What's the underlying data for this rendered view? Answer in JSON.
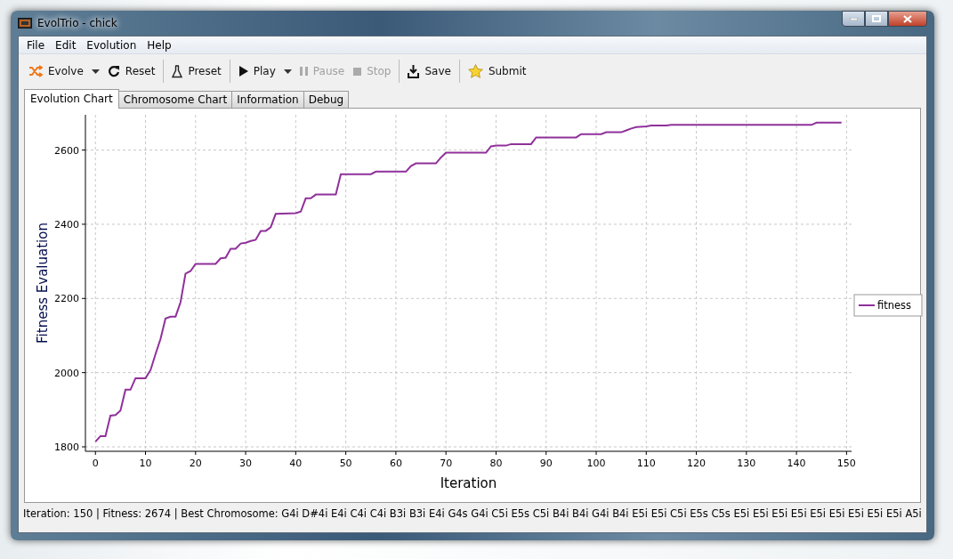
{
  "window": {
    "title": "EvolTrio - chick"
  },
  "menu": [
    "File",
    "Edit",
    "Evolution",
    "Help"
  ],
  "toolbar": [
    {
      "kind": "shuffle",
      "label": "Evolve",
      "dropdown": true,
      "disabled": false,
      "separator_before": false
    },
    {
      "kind": "reset",
      "label": "Reset",
      "dropdown": false,
      "disabled": false,
      "separator_before": false
    },
    {
      "kind": "flask",
      "label": "Preset",
      "dropdown": false,
      "disabled": false,
      "separator_before": true
    },
    {
      "kind": "play",
      "label": "Play",
      "dropdown": true,
      "disabled": false,
      "separator_before": true
    },
    {
      "kind": "pause",
      "label": "Pause",
      "dropdown": false,
      "disabled": true,
      "separator_before": false
    },
    {
      "kind": "stop",
      "label": "Stop",
      "dropdown": false,
      "disabled": true,
      "separator_before": false
    },
    {
      "kind": "save",
      "label": "Save",
      "dropdown": false,
      "disabled": false,
      "separator_before": true
    },
    {
      "kind": "star",
      "label": "Submit",
      "dropdown": false,
      "disabled": false,
      "separator_before": true
    }
  ],
  "tabs": [
    {
      "label": "Evolution Chart",
      "selected": true
    },
    {
      "label": "Chromosome Chart",
      "selected": false
    },
    {
      "label": "Information",
      "selected": false
    },
    {
      "label": "Debug",
      "selected": false
    }
  ],
  "chart_data": {
    "type": "line",
    "grid": true,
    "xlabel": "Iteration",
    "ylabel": "Fitness Evaluation",
    "xlim": [
      -2,
      151
    ],
    "ylim": [
      1788,
      2695
    ],
    "xticks": [
      0,
      10,
      20,
      30,
      40,
      50,
      60,
      70,
      80,
      90,
      100,
      110,
      120,
      130,
      140,
      150
    ],
    "yticks": [
      1800,
      2000,
      2200,
      2400,
      2600
    ],
    "x": [
      0,
      1,
      2,
      3,
      4,
      5,
      6,
      7,
      8,
      10,
      11,
      12,
      13,
      14,
      15,
      16,
      17,
      18,
      19,
      20,
      24,
      25,
      26,
      27,
      28,
      29,
      30,
      31,
      32,
      33,
      34,
      35,
      36,
      40,
      41,
      42,
      43,
      44,
      48,
      49,
      55,
      56,
      62,
      63,
      64,
      68,
      69,
      70,
      78,
      79,
      80,
      82,
      83,
      87,
      88,
      96,
      97,
      101,
      102,
      105,
      106,
      107,
      108,
      110,
      111,
      114,
      115,
      143,
      144,
      149
    ],
    "series": [
      {
        "name": "fitness",
        "color": "#90309a",
        "values": [
          1814,
          1829,
          1829,
          1884,
          1886,
          1898,
          1954,
          1954,
          1985,
          1985,
          2007,
          2050,
          2091,
          2146,
          2151,
          2151,
          2190,
          2267,
          2274,
          2293,
          2293,
          2308,
          2310,
          2334,
          2334,
          2348,
          2350,
          2355,
          2358,
          2382,
          2382,
          2392,
          2428,
          2430,
          2434,
          2470,
          2470,
          2480,
          2480,
          2535,
          2535,
          2542,
          2542,
          2557,
          2564,
          2564,
          2580,
          2593,
          2593,
          2610,
          2612,
          2612,
          2616,
          2616,
          2634,
          2634,
          2643,
          2643,
          2648,
          2648,
          2653,
          2658,
          2662,
          2664,
          2666,
          2666,
          2668,
          2668,
          2674,
          2674
        ]
      }
    ]
  },
  "status_bar": "Iteration: 150 | Fitness: 2674 | Best Chromosome: G4i D#4i E4i C4i C4i B3i B3i E4i G4s G4i C5i E5s C5i B4i B4i G4i B4i E5i E5i C5i E5s C5s E5i E5i E5i E5i E5i E5i E5i E5i E5i A5i"
}
